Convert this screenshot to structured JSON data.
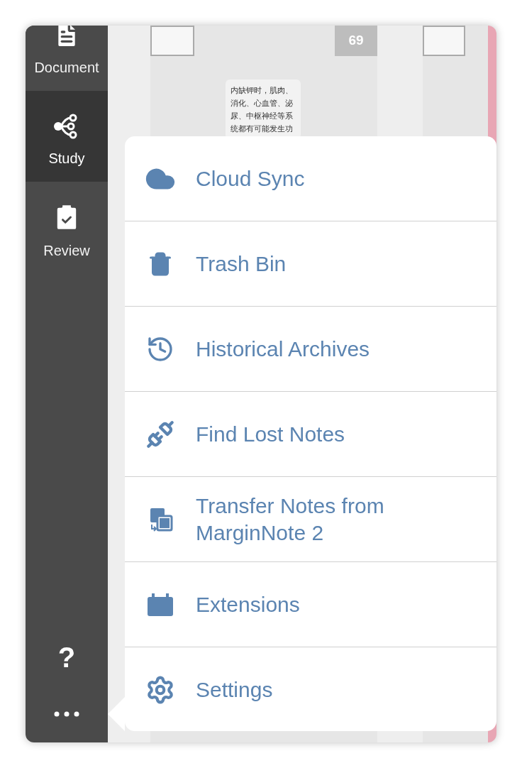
{
  "sidebar": {
    "items": [
      {
        "kind": "document",
        "label": "Document",
        "selected": false
      },
      {
        "kind": "study",
        "label": "Study",
        "selected": true
      },
      {
        "kind": "review",
        "label": "Review",
        "selected": false
      }
    ],
    "help": "?"
  },
  "document_view": {
    "page_number": "69",
    "note": "内缺钾时，肌肉、消化、心血管、泌尿、中枢神经等系统都有可能发生功"
  },
  "menu": {
    "items": [
      {
        "kind": "cloud",
        "label": "Cloud Sync"
      },
      {
        "kind": "trash",
        "label": "Trash Bin"
      },
      {
        "kind": "history",
        "label": "Historical Archives"
      },
      {
        "kind": "plug",
        "label": "Find Lost Notes"
      },
      {
        "kind": "transfer",
        "label": "Transfer Notes from MarginNote 2"
      },
      {
        "kind": "extensions",
        "label": "Extensions"
      },
      {
        "kind": "settings",
        "label": "Settings"
      }
    ]
  }
}
